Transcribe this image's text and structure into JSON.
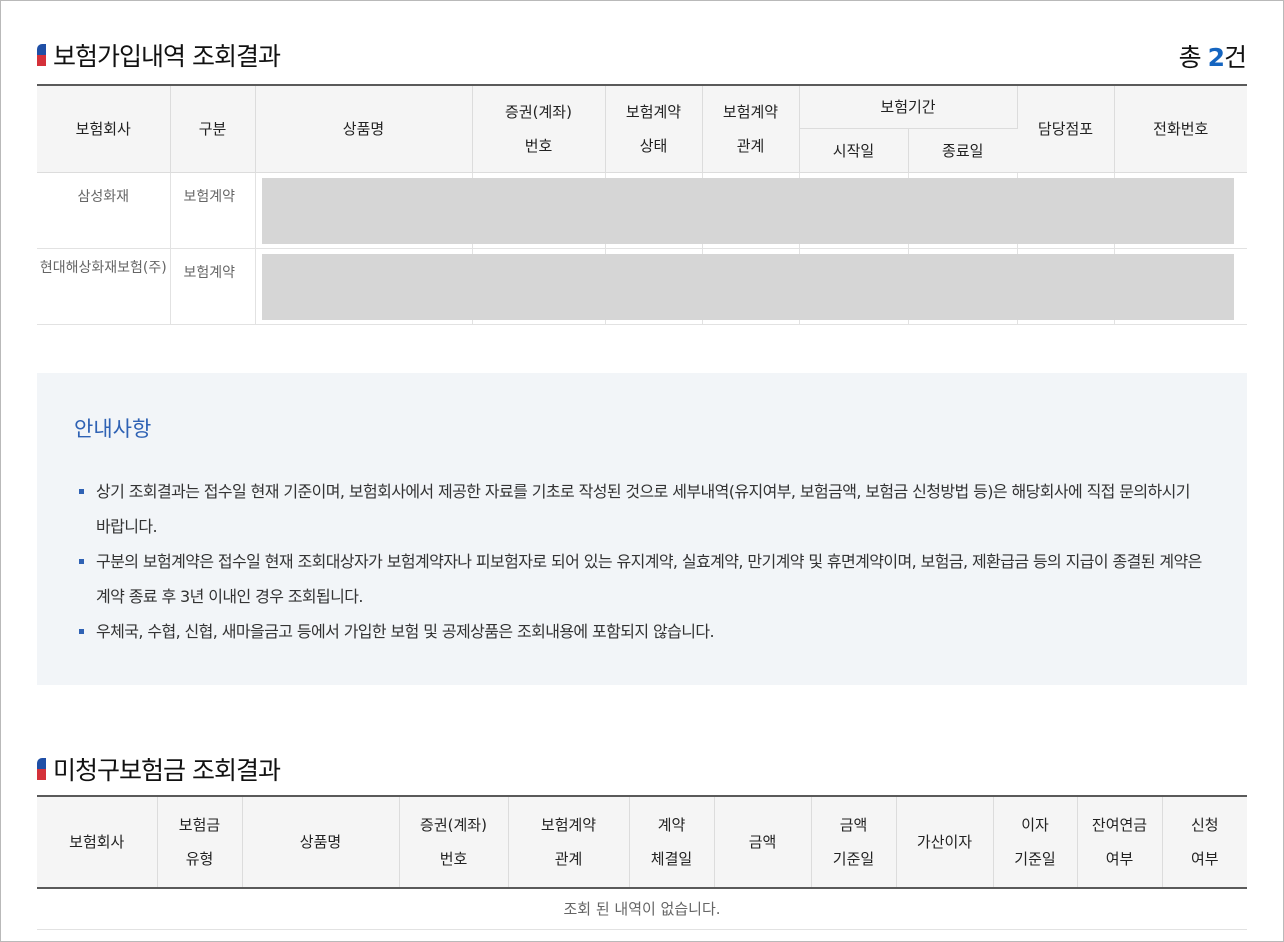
{
  "section1": {
    "title": "보험가입내역 조회결과",
    "count_prefix": "총 ",
    "count_number": "2",
    "count_suffix": "건",
    "headers": {
      "company": "보험회사",
      "type": "구분",
      "product": "상품명",
      "policy_no_1": "증권(계좌)",
      "policy_no_2": "번호",
      "status_1": "보험계약",
      "status_2": "상태",
      "relation_1": "보험계약",
      "relation_2": "관계",
      "period": "보험기간",
      "start": "시작일",
      "end": "종료일",
      "branch": "담당점포",
      "phone": "전화번호"
    },
    "rows": [
      {
        "company": "삼성화재",
        "type": "보험계약"
      },
      {
        "company": "현대해상화재보험(주)",
        "type": "보험계약"
      }
    ]
  },
  "notice": {
    "title": "안내사항",
    "items": [
      "상기 조회결과는 접수일 현재 기준이며, 보험회사에서 제공한 자료를 기초로 작성된 것으로 세부내역(유지여부, 보험금액, 보험금 신청방법 등)은 해당회사에 직접 문의하시기 바랍니다.",
      "구분의 보험계약은 접수일 현재 조회대상자가 보험계약자나 피보험자로 되어 있는 유지계약, 실효계약, 만기계약 및 휴면계약이며, 보험금, 제환급금 등의 지급이 종결된 계약은 계약 종료 후 3년 이내인 경우 조회됩니다.",
      "우체국, 수협, 신협, 새마을금고 등에서 가입한 보험 및 공제상품은 조회내용에 포함되지 않습니다."
    ]
  },
  "section2": {
    "title": "미청구보험금 조회결과",
    "headers": {
      "company": "보험회사",
      "claim_type_1": "보험금",
      "claim_type_2": "유형",
      "product": "상품명",
      "policy_no_1": "증권(계좌)",
      "policy_no_2": "번호",
      "relation_1": "보험계약",
      "relation_2": "관계",
      "contract_date_1": "계약",
      "contract_date_2": "체결일",
      "amount": "금액",
      "amount_date_1": "금액",
      "amount_date_2": "기준일",
      "interest": "가산이자",
      "interest_date_1": "이자",
      "interest_date_2": "기준일",
      "annuity_1": "잔여연금",
      "annuity_2": "여부",
      "apply_1": "신청",
      "apply_2": "여부"
    },
    "empty_message": "조회 된 내역이 없습니다."
  }
}
